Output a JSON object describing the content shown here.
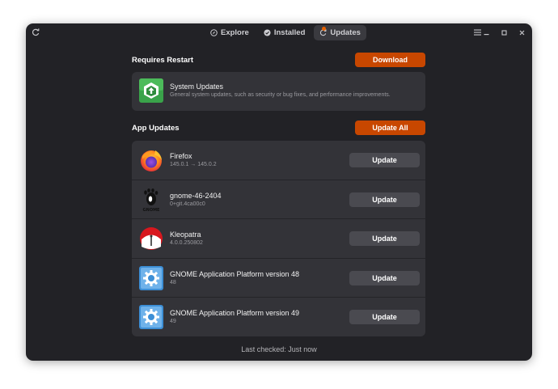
{
  "tabs": [
    {
      "label": "Explore",
      "icon": "compass-icon"
    },
    {
      "label": "Installed",
      "icon": "check-circle-icon"
    },
    {
      "label": "Updates",
      "icon": "refresh-icon",
      "active": true
    }
  ],
  "restart_section": {
    "title": "Requires Restart",
    "button": "Download",
    "item": {
      "name": "System Updates",
      "description": "General system updates, such as security or bug fixes, and performance improvements.",
      "icon": "system-update-icon"
    }
  },
  "apps_section": {
    "title": "App Updates",
    "button": "Update All",
    "items": [
      {
        "name": "Firefox",
        "version": "145.0.1 → 145.0.2",
        "button": "Update",
        "icon": "firefox-icon"
      },
      {
        "name": "gnome-46-2404",
        "version": "0+git.4ca00c0",
        "button": "Update",
        "icon": "gnome-foot-icon"
      },
      {
        "name": "Kleopatra",
        "version": "4.0.0.250802",
        "button": "Update",
        "icon": "kleopatra-icon"
      },
      {
        "name": "GNOME Application Platform version 48",
        "version": "48",
        "button": "Update",
        "icon": "gear-icon"
      },
      {
        "name": "GNOME Application Platform version 49",
        "version": "49",
        "button": "Update",
        "icon": "gear-icon"
      }
    ]
  },
  "footer": "Last checked: Just now",
  "colors": {
    "accent": "#c84700",
    "window_bg": "#222226",
    "card_bg": "#333338"
  }
}
